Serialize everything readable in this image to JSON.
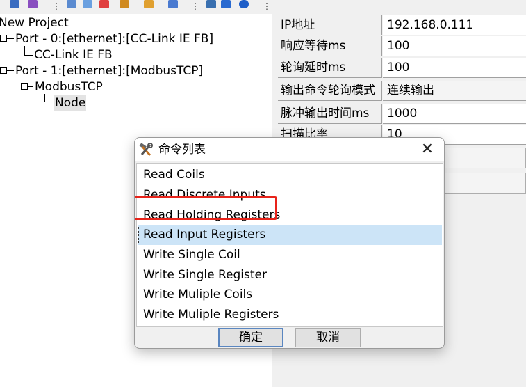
{
  "tree": {
    "root": "New Project",
    "port0": "Port - 0:[ethernet]:[CC-Link IE FB]",
    "ccl": "CC-Link IE FB",
    "port1": "Port - 1:[ethernet]:[ModbusTCP]",
    "modbus": "ModbusTCP",
    "node": "Node"
  },
  "props": {
    "rows": [
      {
        "key": "IP地址",
        "value": "192.168.0.111"
      },
      {
        "key": "响应等待ms",
        "value": "100"
      },
      {
        "key": "轮询延时ms",
        "value": "100"
      },
      {
        "key": "输出命令轮询模式",
        "value": "连续输出"
      },
      {
        "key": "脉冲输出时间ms",
        "value": "1000"
      },
      {
        "key": "扫描比率",
        "value": "10"
      }
    ]
  },
  "dialog": {
    "title": "命令列表",
    "close": "✕",
    "commands": [
      "Read Coils",
      "Read Discrete Inputs",
      "Read Holding Registers",
      "Read Input Registers",
      "Write Single Coil",
      "Write Single Register",
      "Write Muliple Coils",
      "Write Muliple Registers"
    ],
    "selected_index": 3,
    "ok": "确定",
    "cancel": "取消"
  },
  "colors": {
    "highlight_border": "#e8231a",
    "selection_fill": "#cce4f7",
    "default_button_border": "#5a86c0"
  },
  "icons": [
    "tools-icon",
    "close-icon"
  ]
}
